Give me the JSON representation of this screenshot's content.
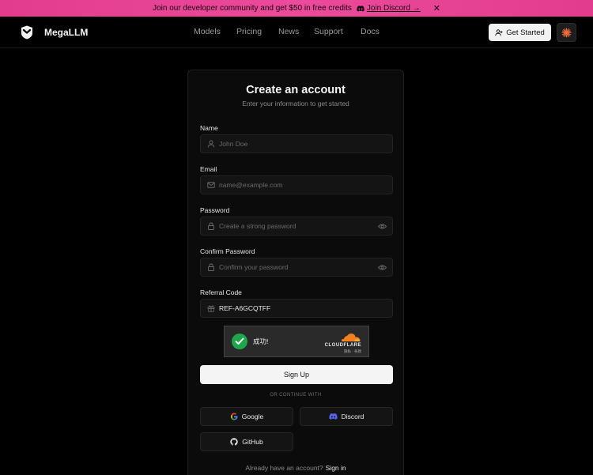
{
  "banner": {
    "text": "Join our developer community and get $50 in free credits",
    "link_text": "Join Discord →",
    "close_symbol": "✕",
    "background": "#e23c8e"
  },
  "nav": {
    "brand": "MegaLLM",
    "links": [
      "Models",
      "Pricing",
      "News",
      "Support",
      "Docs"
    ],
    "get_started": "Get Started",
    "theme_icon": "sun-burst-icon"
  },
  "form": {
    "title": "Create an account",
    "subtitle": "Enter your information to get started",
    "fields": {
      "name": {
        "label": "Name",
        "placeholder": "John Doe",
        "value": ""
      },
      "email": {
        "label": "Email",
        "placeholder": "name@example.com",
        "value": ""
      },
      "password": {
        "label": "Password",
        "placeholder": "Create a strong password",
        "value": ""
      },
      "confirm": {
        "label": "Confirm Password",
        "placeholder": "Confirm your password",
        "value": ""
      },
      "referral": {
        "label": "Referral Code",
        "placeholder": "",
        "value": "REF-A6GCQTFF"
      }
    },
    "captcha": {
      "status": "成功!",
      "provider": "CLOUDFLARE",
      "links": "隐私 · 条款"
    },
    "signup_label": "Sign Up",
    "divider": "OR CONTINUE WITH",
    "oauth": {
      "google": "Google",
      "discord": "Discord",
      "github": "GitHub"
    },
    "signin_prompt": "Already have an account?",
    "signin_link": "Sign in"
  },
  "colors": {
    "accent": "#e23c8e",
    "success": "#1ea74a",
    "cloudflare": "#f38020",
    "discord": "#5865f2"
  }
}
